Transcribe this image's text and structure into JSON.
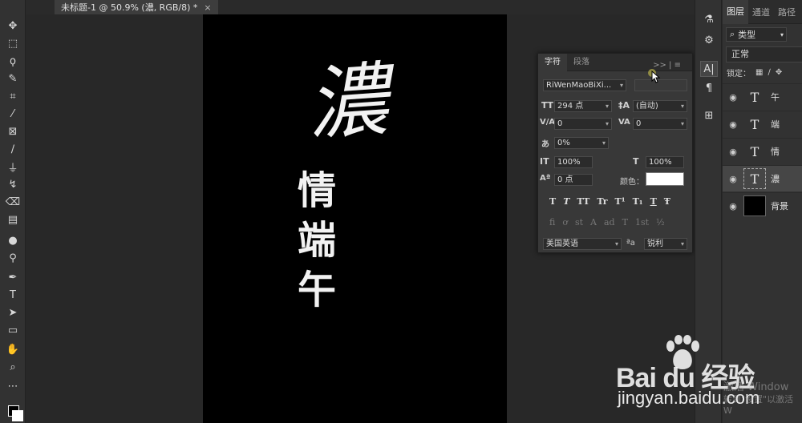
{
  "document": {
    "tab_title": "未标题-1 @ 50.9% (濃, RGB/8) *",
    "close_symbol": "×"
  },
  "canvas": {
    "big_char": "濃",
    "small_chars": [
      "情",
      "端",
      "午"
    ],
    "background": "#000000",
    "text_color": "#ffffff"
  },
  "character_panel": {
    "tabs": [
      "字符",
      "段落"
    ],
    "menu": ">> | ≡",
    "font_family": "RiWenMaoBiXi...",
    "font_size": "294 点",
    "leading": "(自动)",
    "kerning": "0",
    "tracking": "0",
    "baseline_scale": "0%",
    "vertical_scale": "100%",
    "horizontal_scale": "100%",
    "baseline_shift": "0 点",
    "color_label": "颜色：",
    "color_value": "#ffffff",
    "style_buttons": [
      "T",
      "T",
      "TT",
      "Tr",
      "T¹",
      "T₁",
      "T",
      "Ŧ"
    ],
    "opentype_buttons": [
      "fi",
      "ơ",
      "st",
      "A",
      "ad",
      "T",
      "1st",
      "½"
    ],
    "language": "美国英语",
    "aa_label": "ªa",
    "antialias": "锐利"
  },
  "layers_panel": {
    "tabs": [
      "图层",
      "通道",
      "路径"
    ],
    "filter_label": "类型",
    "blend_mode": "正常",
    "lock_label": "锁定：",
    "layers": [
      {
        "name": "午",
        "type": "text",
        "selected": false
      },
      {
        "name": "端",
        "type": "text",
        "selected": false
      },
      {
        "name": "情",
        "type": "text",
        "selected": false
      },
      {
        "name": "濃",
        "type": "text",
        "selected": true
      },
      {
        "name": "背景",
        "type": "image",
        "selected": false
      }
    ]
  },
  "watermark": {
    "brand": "Bai du 经验",
    "url": "jingyan.baidu.com",
    "activate": "激活 Window",
    "activate_sub": "转到\"设置\"以激活 W"
  }
}
